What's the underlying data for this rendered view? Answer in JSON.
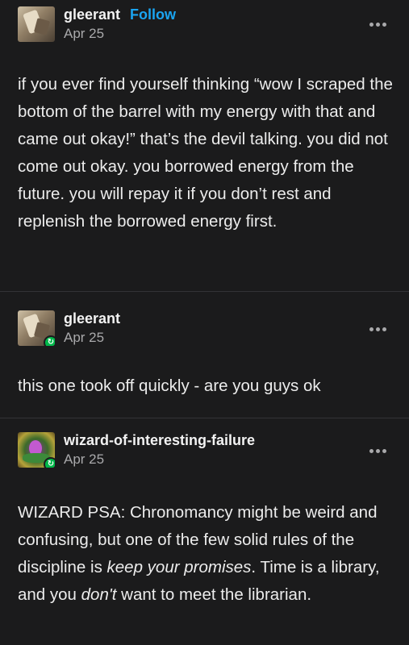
{
  "posts": [
    {
      "username": "gleerant",
      "follow_label": "Follow",
      "date": "Apr 25",
      "avatar_icon": "user-avatar",
      "body": "if you ever find yourself thinking “wow I scraped the bottom of the barrel with my energy with that and came out okay!” that’s the devil talking. you did not come out okay. you borrowed energy from the future. you will repay it if you don’t rest and replenish the borrowed energy first."
    },
    {
      "username": "gleerant",
      "date": "Apr 25",
      "avatar_icon": "user-avatar",
      "badge_icon": "reblog-icon",
      "body": "this one took off quickly - are you guys ok"
    },
    {
      "username": "wizard-of-interesting-failure",
      "date": "Apr 25",
      "avatar_icon": "user-avatar",
      "badge_icon": "reblog-icon",
      "body_parts": {
        "p1": "WIZARD PSA: Chronomancy might be weird and confusing, but one of the few solid rules of the discipline is ",
        "em1": "keep your promises",
        "p2": ". Time is a library, and you ",
        "em2": "don't",
        "p3": " want to meet the librarian."
      }
    }
  ],
  "colors": {
    "background": "#1b1b1c",
    "text": "#ececec",
    "follow": "#1aa5f2",
    "muted": "#a9a9ab",
    "reblog_badge": "#00b84a"
  },
  "more_icon": "more-options-icon"
}
